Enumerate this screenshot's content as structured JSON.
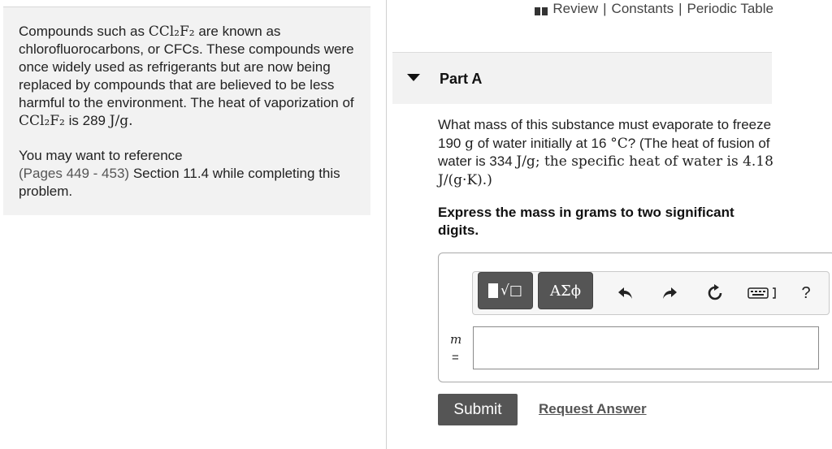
{
  "intro": {
    "p1_a": "Compounds such as ",
    "formula": "CCl₂F₂",
    "p1_b": " are known as chlorofluorocarbons, or CFCs. These compounds were once widely used as refrigerants but are now being replaced by compounds that are believed to be less harmful to the environment. The heat of vaporization of ",
    "p1_c": " is 289 ",
    "unit": "J/g",
    "p1_d": ".",
    "p2_a": "You may want to reference",
    "pages_link": "(Pages 449 - 453)",
    "p2_b": " Section 11.4 while completing this problem."
  },
  "top_links": {
    "review": "Review",
    "separator": "|",
    "constants": "Constants",
    "periodic_table": "Periodic Table"
  },
  "part": {
    "title": "Part A"
  },
  "question": {
    "q_a": "What mass of this substance must evaporate to freeze 190 ",
    "g": "g",
    "q_b": " of water initially at 16 ",
    "degC": "°C",
    "q_c": "? (The heat of fusion of water is 334 ",
    "jg": "J/g",
    "q_d": "; the specific heat of water is 4.18 ",
    "jgk": "J/(g·K)",
    "q_e": ".)",
    "instruction": "Express the mass in grams to two significant digits."
  },
  "answer": {
    "variable": "m",
    "equals": "=",
    "value": "",
    "toolbar": {
      "templates_label": "√□",
      "symbols_label": "ΑΣϕ",
      "help": "?"
    }
  },
  "actions": {
    "submit": "Submit",
    "request_answer": "Request Answer"
  }
}
